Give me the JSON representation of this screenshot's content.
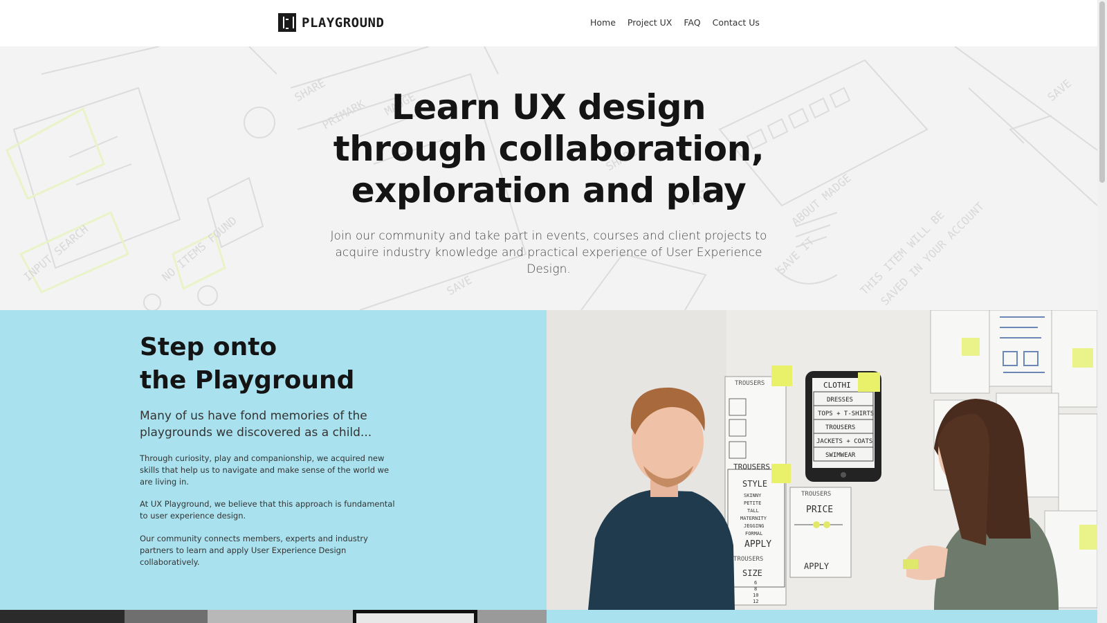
{
  "header": {
    "logo_text": "PLAYGROUND",
    "nav": [
      {
        "label": "Home"
      },
      {
        "label": "Project UX"
      },
      {
        "label": "FAQ"
      },
      {
        "label": "Contact Us"
      }
    ]
  },
  "hero": {
    "title_lines": [
      "Learn UX design",
      "through collaboration,",
      "exploration and play"
    ],
    "subtitle": "Join our community and take part in events, courses and client projects to acquire industry knowledge and practical experience of User Experience Design."
  },
  "intro": {
    "heading_lines": [
      "Step onto",
      "the Playground"
    ],
    "lead": "Many of us have fond memories of the playgrounds we discovered as a child...",
    "paragraphs": [
      "Through curiosity, play and companionship, we acquired new skills that help us to navigate and make sense of the world we are living in.",
      "At UX Playground, we believe that this approach is fundamental to user experience design.",
      "Our community connects members, experts and industry partners to learn and apply User Experience Design collaboratively."
    ]
  },
  "photo": {
    "wall_labels": {
      "clothing": "CLOTHI",
      "menu_items": [
        "DRESSES",
        "TOPS + T-SHIRTS",
        "TROUSERS",
        "JACKETS + COATS",
        "SWIMWEAR"
      ],
      "trousers_top": "TROUSERS",
      "trousers_mid": "TROUSERS",
      "trousers_low": "TROUSERS",
      "trousers_right": "TROUSERS",
      "style": "STYLE",
      "style_items": [
        "SKINNY",
        "PETITE",
        "TALL",
        "MATERNITY",
        "JEGGING",
        "FORMAL"
      ],
      "apply_left": "APPLY",
      "size": "SIZE",
      "size_items": [
        "6",
        "8",
        "10",
        "12"
      ],
      "price": "PRICE",
      "apply_right": "APPLY"
    }
  },
  "colors": {
    "accent_teal": "#a9e2ee",
    "hero_bg": "#f3f3f3",
    "heading": "#141414",
    "sticky_note": "#e8f06a"
  }
}
